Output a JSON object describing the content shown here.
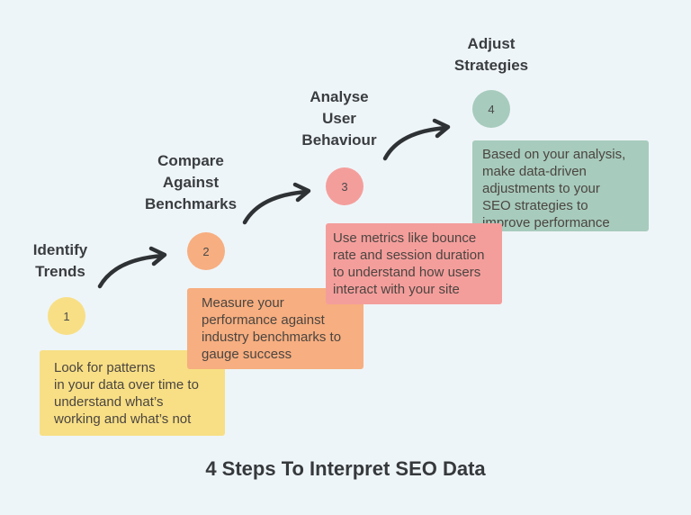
{
  "title": "4 Steps To Interpret SEO Data",
  "colors": {
    "background": "#eef5f8",
    "text": "#3a3d40",
    "arrow": "#2f3235"
  },
  "steps": [
    {
      "number": "1",
      "heading_lines": [
        "Identify",
        "Trends"
      ],
      "description_lines": [
        "Look for patterns",
        "in your data over time to",
        "understand what’s",
        "working and what’s not"
      ],
      "color": "#f8df85"
    },
    {
      "number": "2",
      "heading_lines": [
        "Compare",
        "Against",
        "Benchmarks"
      ],
      "description_lines": [
        "Measure your",
        "performance against",
        "industry benchmarks to",
        "gauge success"
      ],
      "color": "#f7ae80"
    },
    {
      "number": "3",
      "heading_lines": [
        "Analyse",
        "User",
        "Behaviour"
      ],
      "description_lines": [
        "Use metrics like bounce",
        "rate and session duration",
        "to understand how users",
        "interact with your site"
      ],
      "color": "#f49e9c"
    },
    {
      "number": "4",
      "heading_lines": [
        "Adjust",
        "Strategies"
      ],
      "description_lines": [
        "Based on your analysis,",
        "make data-driven",
        "adjustments to your",
        "SEO strategies to",
        "improve performance"
      ],
      "color": "#a7cbbd"
    }
  ],
  "connectors": [
    "arrow-right-curved",
    "arrow-right-curved",
    "arrow-right-curved"
  ]
}
